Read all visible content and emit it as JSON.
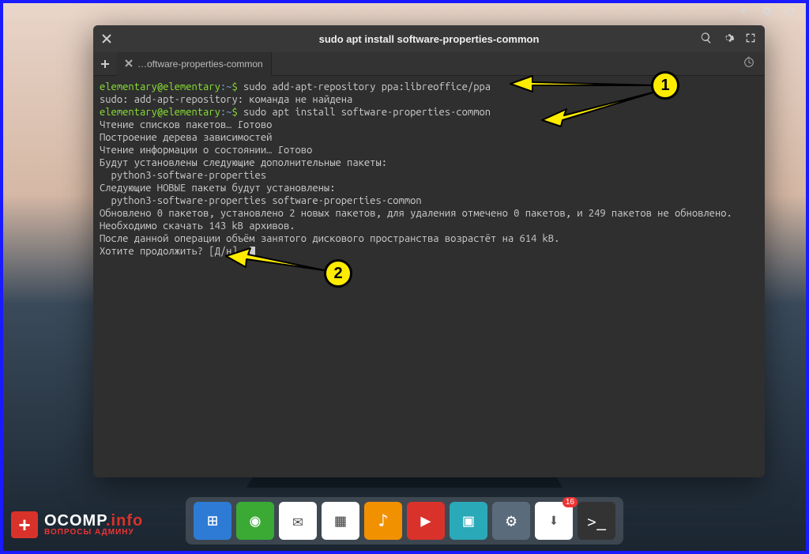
{
  "topbar": {
    "sound": "sound-icon",
    "settings": "settings-icon",
    "power": "power-icon"
  },
  "window": {
    "title": "sudo apt install software-properties-common",
    "tab_label": "…oftware-properties-common"
  },
  "terminal": {
    "prompt_user": "elementary@elementary",
    "prompt_sep": ":",
    "prompt_path": "~",
    "prompt_end": "$",
    "cmd1": "sudo add-apt-repository ppa:libreoffice/ppa",
    "err1": "sudo: add-apt-repository: команда не найдена",
    "cmd2": "sudo apt install software-properties-common",
    "out": [
      "Чтение списков пакетов… Готово",
      "Построение дерева зависимостей",
      "Чтение информации о состоянии… Готово",
      "Будут установлены следующие дополнительные пакеты:",
      "  python3-software-properties",
      "Следующие НОВЫЕ пакеты будут установлены:",
      "  python3-software-properties software-properties-common",
      "Обновлено 0 пакетов, установлено 2 новых пакетов, для удаления отмечено 0 пакетов, и 249 пакетов не обновлено.",
      "Необходимо скачать 143 kB архивов.",
      "После данной операции объём занятого дискового пространства возрастёт на 614 kB.",
      "Хотите продолжить? [Д/н] д"
    ]
  },
  "callouts": {
    "one": "1",
    "two": "2"
  },
  "dock": {
    "items": [
      {
        "name": "multitasking",
        "glyph": "⊞",
        "cls": "blue"
      },
      {
        "name": "browser",
        "glyph": "◉",
        "cls": "green"
      },
      {
        "name": "mail",
        "glyph": "✉",
        "cls": "white"
      },
      {
        "name": "calendar",
        "glyph": "▦",
        "cls": "white"
      },
      {
        "name": "music",
        "glyph": "♪",
        "cls": "orange"
      },
      {
        "name": "videos",
        "glyph": "▶",
        "cls": "red"
      },
      {
        "name": "photos",
        "glyph": "▣",
        "cls": "teal"
      },
      {
        "name": "switchboard",
        "glyph": "⚙",
        "cls": "slate"
      },
      {
        "name": "appcenter",
        "glyph": "⬇",
        "cls": "white",
        "badge": "16"
      },
      {
        "name": "terminal",
        "glyph": ">_",
        "cls": "dark"
      }
    ]
  },
  "logo": {
    "main1": "OCOMP",
    "main2": ".info",
    "sub": "ВОПРОСЫ АДМИНУ"
  }
}
